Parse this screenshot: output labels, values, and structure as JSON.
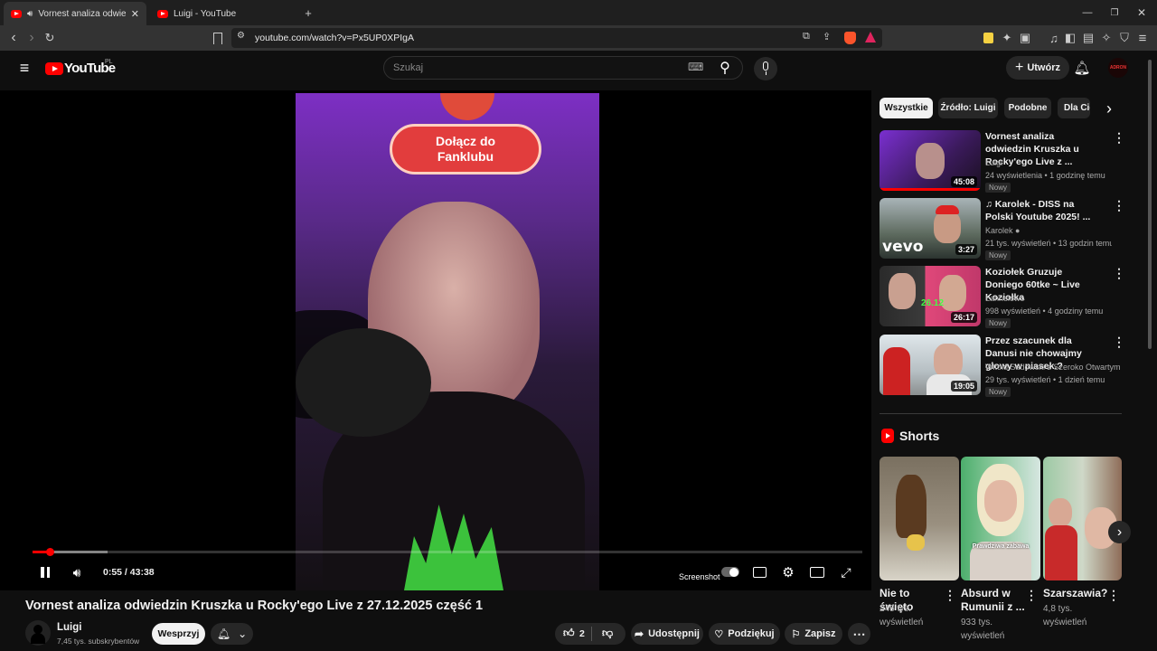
{
  "browser": {
    "tabs": [
      {
        "label": "Vornest analiza odwiedzin Kr..."
      },
      {
        "label": "Luigi - YouTube"
      }
    ],
    "new_tab": "+",
    "url": "youtube.com/watch?v=Px5UP0XPIgA"
  },
  "header": {
    "logo": "YouTube",
    "region": "PL",
    "search_placeholder": "Szukaj",
    "create_label": "Utwórz",
    "avatar_text": "ADRON"
  },
  "player": {
    "overlay_text": "Dołącz do Fanklubu",
    "time": "0:55 / 43:38",
    "progress": 0.021,
    "buffered": 0.09,
    "screenshot_label": "Screenshot"
  },
  "video": {
    "title": "Vornest analiza odwiedzin Kruszka u Rocky'ego Live z 27.12.2025 część 1",
    "channel": "Luigi",
    "subscribers": "7,45 tys. subskrybentów",
    "support_label": "Wesprzyj",
    "likes": "2",
    "share_label": "Udostępnij",
    "thanks_label": "Podziękuj",
    "save_label": "Zapisz"
  },
  "chips": [
    "Wszystkie",
    "Źródło: Luigi",
    "Podobne",
    "Dla Ciebie"
  ],
  "recommendations": [
    {
      "title": "Vornest analiza odwiedzin Kruszka u Rocky'ego Live z ...",
      "channel": "Luigi",
      "meta": "24 wyświetlenia • 1 godzinę temu",
      "badge": "Nowy",
      "duration": "45:08"
    },
    {
      "title": "♫ Karolek - DISS na Polski Youtube 2025! ...",
      "channel": "Karolek",
      "meta": "21 tys. wyświetleń • 13 godzin temu",
      "badge": "Nowy",
      "duration": "3:27"
    },
    {
      "title": "Koziołek Gruzuje Doniego 60tke ~ Live Koziołka",
      "channel": "Lannelowo",
      "meta": "998 wyświetleń • 4 godziny temu",
      "badge": "Nowy",
      "duration": "26:17"
    },
    {
      "title": "Przez szacunek dla Danusi nie chowajmy głowy w piasek.?",
      "channel": "Witold Sadowski z Szeroko Otwartymi O...",
      "meta": "29 tys. wyświetleń • 1 dzień temu",
      "badge": "Nowy",
      "duration": "19:05"
    }
  ],
  "shorts": {
    "heading": "Shorts",
    "items": [
      {
        "title": "Nie to święto",
        "views": "245 tys. wyświetleń"
      },
      {
        "title": "Absurd w Rumunii z ...",
        "views": "933 tys. wyświetleń"
      },
      {
        "title": "Szarszawia?",
        "views": "4,8 tys. wyświetleń"
      }
    ],
    "caption_2": "Prawdziwa zabawa"
  },
  "colors": {
    "accent": "#ff0000",
    "bg": "#0f0f0f",
    "chip": "#272727"
  }
}
